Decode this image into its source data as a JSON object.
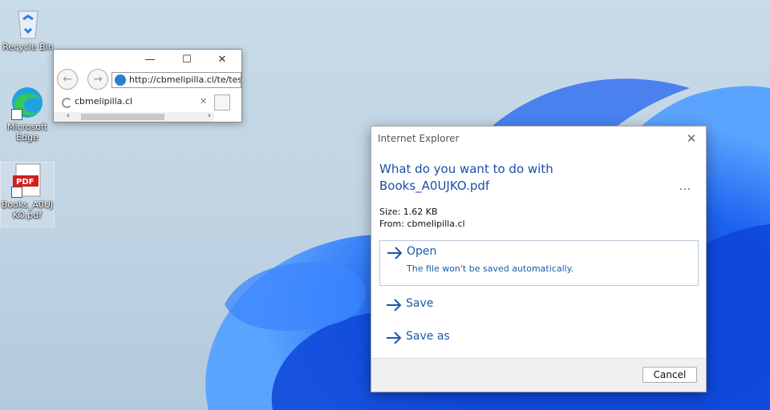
{
  "desktop": {
    "icons": [
      {
        "label": "Recycle Bin"
      },
      {
        "label": "Microsoft Edge"
      },
      {
        "label": "Books_A0UJKO.pdf",
        "badge": "PDF"
      }
    ]
  },
  "ie_window": {
    "address": "http://cbmelipilla.cl/te/tes",
    "tab_title": "cbmelipilla.cl",
    "controls": {
      "minimize": "—",
      "maximize": "☐",
      "close": "✕"
    }
  },
  "dialog": {
    "title": "Internet Explorer",
    "question_line1": "What do you want to do with",
    "question_line2": "Books_A0UJKO.pdf",
    "more": "...",
    "size": "Size: 1.62 KB",
    "from": "From: cbmelipilla.cl",
    "options": {
      "open": {
        "label": "Open",
        "sub": "The file won't be saved automatically."
      },
      "save": {
        "label": "Save"
      },
      "save_as": {
        "label": "Save as"
      }
    },
    "cancel": "Cancel",
    "close": "✕"
  },
  "colors": {
    "accent": "#1a5aa8",
    "link": "#1a4fa8"
  }
}
